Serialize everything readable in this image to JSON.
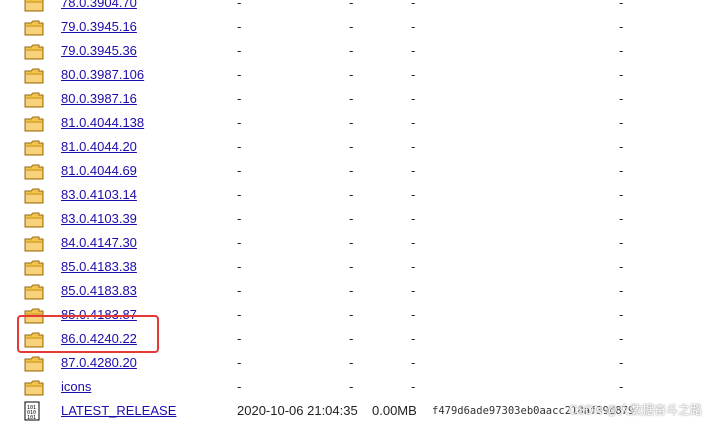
{
  "listing": {
    "rows": [
      {
        "name": "78.0.3904.70",
        "type": "folder",
        "date": "-",
        "size": "-",
        "etag": "",
        "tail": "-"
      },
      {
        "name": "79.0.3945.16",
        "type": "folder",
        "date": "-",
        "size": "-",
        "etag": "",
        "tail": "-"
      },
      {
        "name": "79.0.3945.36",
        "type": "folder",
        "date": "-",
        "size": "-",
        "etag": "",
        "tail": "-"
      },
      {
        "name": "80.0.3987.106",
        "type": "folder",
        "date": "-",
        "size": "-",
        "etag": "",
        "tail": "-"
      },
      {
        "name": "80.0.3987.16",
        "type": "folder",
        "date": "-",
        "size": "-",
        "etag": "",
        "tail": "-"
      },
      {
        "name": "81.0.4044.138",
        "type": "folder",
        "date": "-",
        "size": "-",
        "etag": "",
        "tail": "-"
      },
      {
        "name": "81.0.4044.20",
        "type": "folder",
        "date": "-",
        "size": "-",
        "etag": "",
        "tail": "-"
      },
      {
        "name": "81.0.4044.69",
        "type": "folder",
        "date": "-",
        "size": "-",
        "etag": "",
        "tail": "-"
      },
      {
        "name": "83.0.4103.14",
        "type": "folder",
        "date": "-",
        "size": "-",
        "etag": "",
        "tail": "-"
      },
      {
        "name": "83.0.4103.39",
        "type": "folder",
        "date": "-",
        "size": "-",
        "etag": "",
        "tail": "-"
      },
      {
        "name": "84.0.4147.30",
        "type": "folder",
        "date": "-",
        "size": "-",
        "etag": "",
        "tail": "-"
      },
      {
        "name": "85.0.4183.38",
        "type": "folder",
        "date": "-",
        "size": "-",
        "etag": "",
        "tail": "-"
      },
      {
        "name": "85.0.4183.83",
        "type": "folder",
        "date": "-",
        "size": "-",
        "etag": "",
        "tail": "-"
      },
      {
        "name": "85.0.4183.87",
        "type": "folder",
        "date": "-",
        "size": "-",
        "etag": "",
        "tail": "-"
      },
      {
        "name": "86.0.4240.22",
        "type": "folder",
        "date": "-",
        "size": "-",
        "etag": "",
        "tail": "-"
      },
      {
        "name": "87.0.4280.20",
        "type": "folder",
        "date": "-",
        "size": "-",
        "etag": "",
        "tail": "-"
      },
      {
        "name": "icons",
        "type": "folder",
        "date": "-",
        "size": "-",
        "etag": "",
        "tail": "-"
      },
      {
        "name": "LATEST_RELEASE",
        "type": "file",
        "date": "2020-10-06 21:04:35",
        "size": "0.00MB",
        "etag": "f479d6ade97303eb0aacc218af39d879",
        "tail": ""
      }
    ]
  },
  "watermark": "CSDN @大数据奋斗之路",
  "colors": {
    "link": "#1a0dab",
    "folder_fill": "#f2c14e",
    "folder_stroke": "#9a6a12",
    "highlight": "#e53935"
  },
  "icons": {
    "folder": "folder-icon",
    "file": "binary-file-icon"
  }
}
